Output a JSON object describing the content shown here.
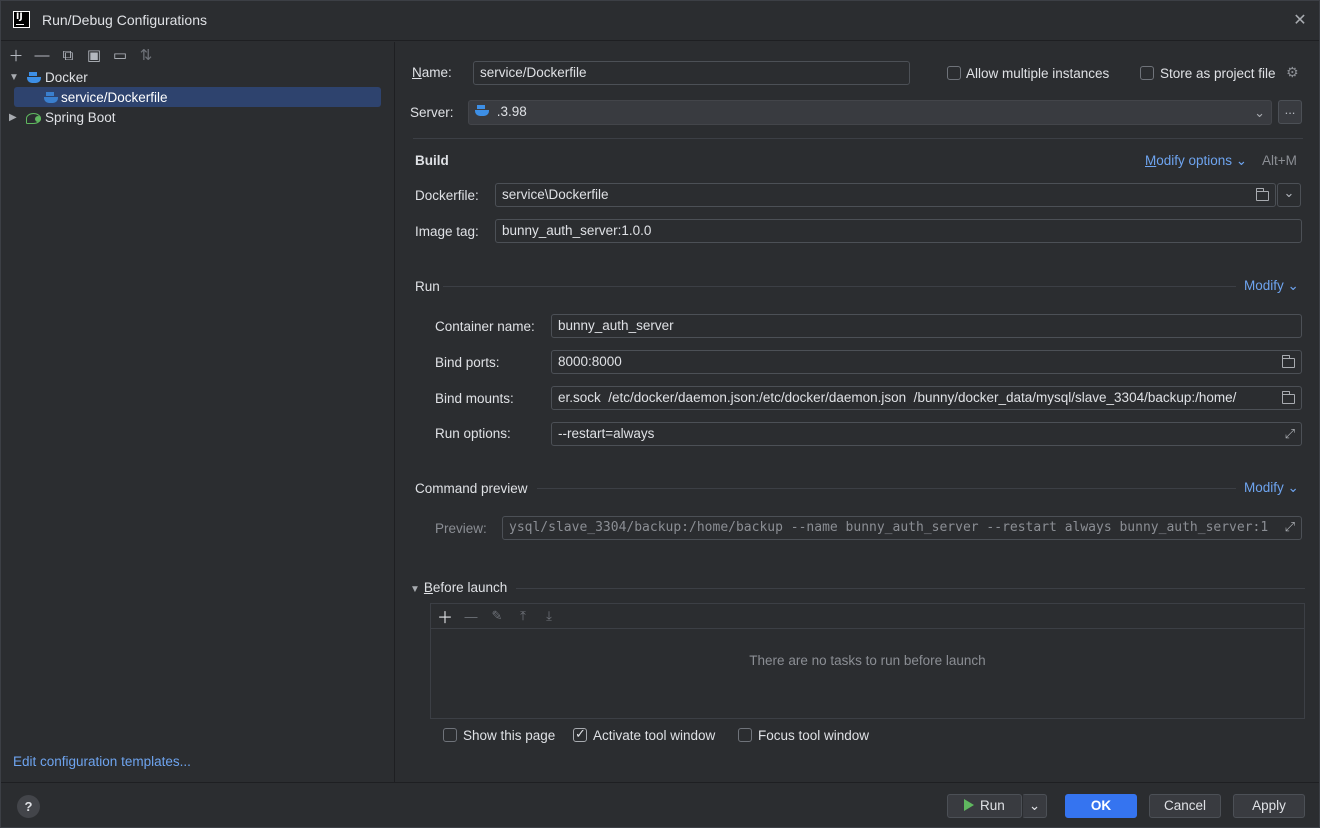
{
  "window": {
    "title": "Run/Debug Configurations"
  },
  "sidebar": {
    "tree": [
      {
        "label": "Docker",
        "expanded": true
      },
      {
        "label": "service/Dockerfile",
        "selected": true
      },
      {
        "label": "Spring Boot",
        "expanded": false
      }
    ],
    "edit_templates": "Edit configuration templates..."
  },
  "form": {
    "name_label": "Name:",
    "name_value": "service/Dockerfile",
    "allow_multiple": {
      "label": "Allow multiple instances",
      "checked": false
    },
    "store_project": {
      "label": "Store as project file",
      "checked": false
    },
    "server_label": "Server:",
    "server_value": ".3.98",
    "server_more": "...",
    "build": {
      "title": "Build",
      "modify": "Modify options",
      "shortcut": "Alt+M",
      "dockerfile_label": "Dockerfile:",
      "dockerfile_value": "service\\Dockerfile",
      "image_tag_label": "Image tag:",
      "image_tag_value": "bunny_auth_server:1.0.0"
    },
    "run": {
      "title": "Run",
      "modify": "Modify",
      "container_label": "Container name:",
      "container_value": "bunny_auth_server",
      "ports_label": "Bind ports:",
      "ports_value": "8000:8000",
      "mounts_label": "Bind mounts:",
      "mounts_value": "er.sock  /etc/docker/daemon.json:/etc/docker/daemon.json  /bunny/docker_data/mysql/slave_3304/backup:/home/",
      "options_label": "Run options:",
      "options_value": "--restart=always"
    },
    "preview": {
      "title": "Command preview",
      "modify": "Modify",
      "label": "Preview:",
      "value": "ysql/slave_3304/backup:/home/backup --name bunny_auth_server --restart always bunny_auth_server:1"
    },
    "before_launch": {
      "title": "Before launch",
      "empty": "There are no tasks to run before launch"
    },
    "show_page": {
      "label": "Show this page",
      "checked": false
    },
    "activate_tool": {
      "label": "Activate tool window",
      "checked": true
    },
    "focus_tool": {
      "label": "Focus tool window",
      "checked": false
    }
  },
  "footer": {
    "help": "?",
    "run": "Run",
    "ok": "OK",
    "cancel": "Cancel",
    "apply": "Apply"
  }
}
